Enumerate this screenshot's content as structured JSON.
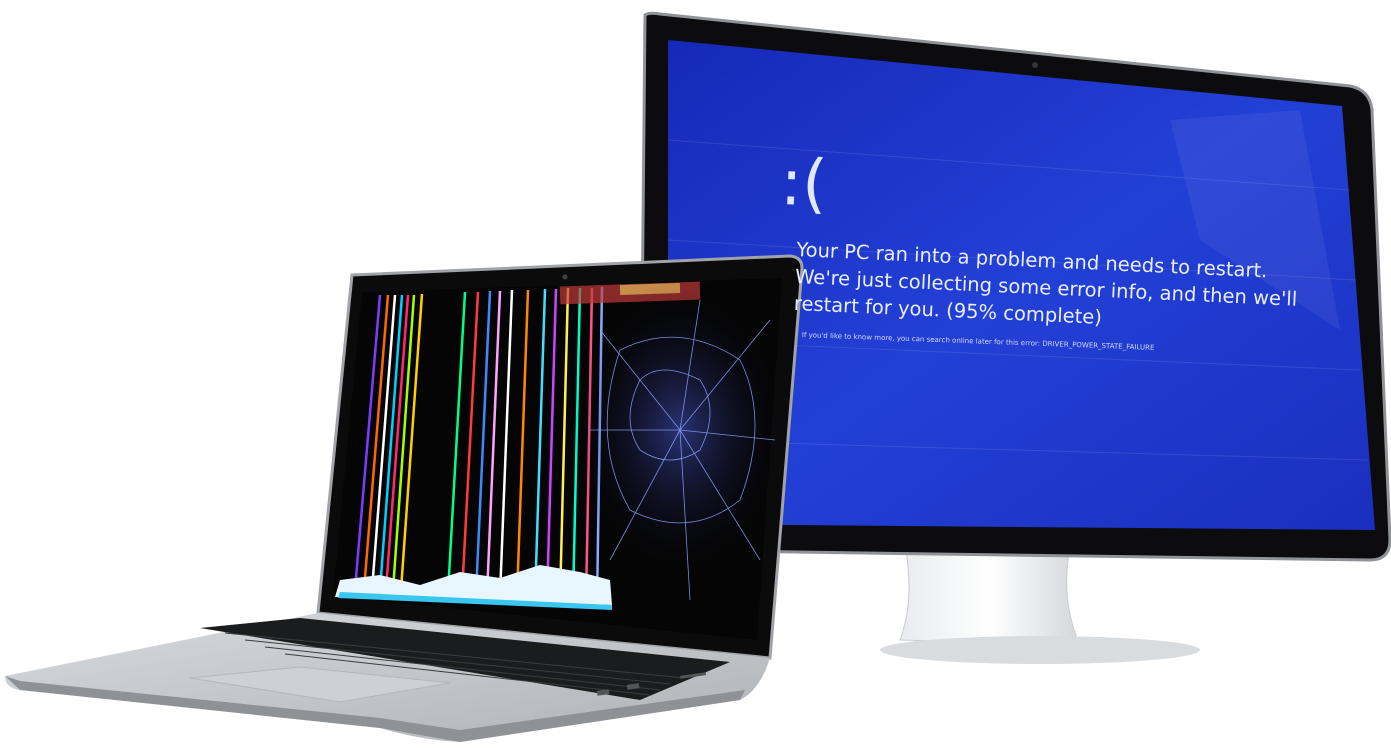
{
  "scene": {
    "description_tag": "laptop-and-monitor-photo",
    "colors": {
      "background": "#ffffff",
      "bsod_blue": "#1f33c7",
      "bezel": "#111111",
      "aluminum": "#c9ccd0"
    }
  },
  "monitor": {
    "bsod": {
      "face": ":(",
      "message": "Your PC ran into a problem and needs to restart. We're just collecting some error info, and then we'll restart for you. (95% complete)",
      "info": "If you'd like to know more, you can search online later for this error: DRIVER_POWER_STATE_FAILURE"
    }
  },
  "laptop": {
    "screen_state": "cracked-with-color-lines"
  }
}
